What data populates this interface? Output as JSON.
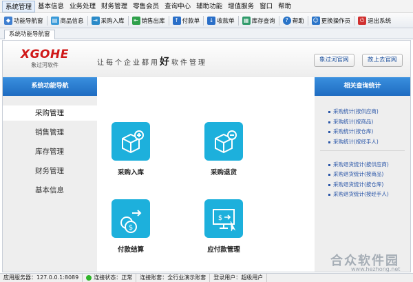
{
  "menubar": {
    "items": [
      "系统管理",
      "基本信息",
      "业务处理",
      "财务管理",
      "零售会员",
      "查询中心",
      "辅助功能",
      "增值服务",
      "窗口",
      "帮助"
    ]
  },
  "toolbar": {
    "buttons": [
      {
        "label": "功能导航窗",
        "icon": "nav-icon",
        "color": "#3f7fd0"
      },
      {
        "label": "商品信息",
        "icon": "goods-icon",
        "color": "#3a9ad8"
      },
      {
        "label": "采购入库",
        "icon": "purchase-in-icon",
        "color": "#2a8ac8"
      },
      {
        "label": "销售出库",
        "icon": "sales-out-icon",
        "color": "#2fa04a"
      },
      {
        "label": "付款单",
        "icon": "payment-icon",
        "color": "#2a6fc8"
      },
      {
        "label": "收款单",
        "icon": "receipt-icon",
        "color": "#2a6fc8"
      },
      {
        "label": "库存查询",
        "icon": "stock-query-icon",
        "color": "#2f9a6a"
      },
      {
        "label": "帮助",
        "icon": "help-icon",
        "color": "#2a74c8"
      },
      {
        "label": "更换操作员",
        "icon": "switch-user-icon",
        "color": "#2a74c8"
      },
      {
        "label": "退出系统",
        "icon": "exit-icon",
        "color": "#d03030"
      }
    ]
  },
  "tabs": {
    "active": "系统功能导航窗"
  },
  "header": {
    "logo": "XGOHE",
    "logo_sub": "象过河软件",
    "slogan_a": "让每个企业都用",
    "slogan_big": "好",
    "slogan_b": "软件管理",
    "btn_site": "象过河官网",
    "btn_old_site": "故上去官网"
  },
  "leftnav": {
    "title": "系统功能导航",
    "items": [
      "采购管理",
      "销售管理",
      "库存管理",
      "财务管理",
      "基本信息"
    ]
  },
  "tiles": [
    {
      "label": "采购入库",
      "icon": "box-plus-icon"
    },
    {
      "label": "采购退货",
      "icon": "box-minus-icon"
    },
    {
      "label": "付款结算",
      "icon": "coins-arrow-icon"
    },
    {
      "label": "应付款管理",
      "icon": "monitor-dollar-icon"
    }
  ],
  "rightpanel": {
    "title": "相关查询统计",
    "group1": [
      "采购统计(按供应商)",
      "采购统计(按商品)",
      "采购统计(按仓库)",
      "采购统计(按经手人)"
    ],
    "group2": [
      "采购退货统计(按供应商)",
      "采购退货统计(按商品)",
      "采购退货统计(按仓库)",
      "采购退货统计(按经手人)"
    ]
  },
  "statusbar": {
    "server": "应用服务器：127.0.0.1:8089",
    "conn": "连接状态：正常",
    "account": "连接账套：全行业演示账套",
    "user": "登录用户：超级用户"
  },
  "watermark": {
    "text": "合众软件园",
    "url": "www.hezhong.net"
  }
}
